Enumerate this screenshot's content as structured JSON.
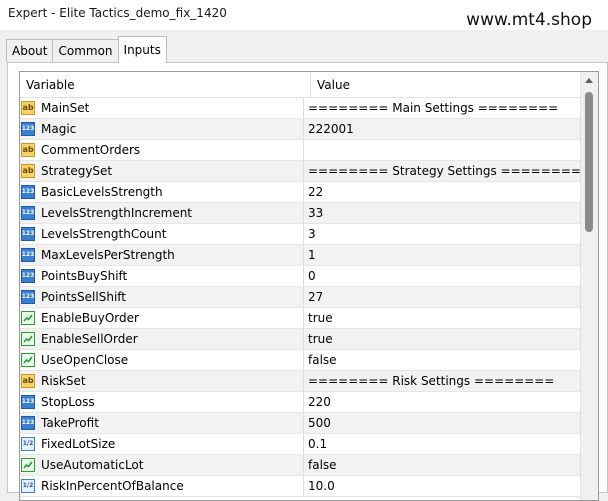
{
  "window": {
    "title": "Expert - Elite Tactics_demo_fix_1420",
    "watermark": "www.mt4.shop"
  },
  "tabs": [
    {
      "label": "About",
      "active": false
    },
    {
      "label": "Common",
      "active": false
    },
    {
      "label": "Inputs",
      "active": true
    }
  ],
  "grid": {
    "headers": {
      "variable": "Variable",
      "value": "Value"
    },
    "rows": [
      {
        "type": "string",
        "name": "MainSet",
        "value": "======== Main Settings ========"
      },
      {
        "type": "int",
        "name": "Magic",
        "value": "222001"
      },
      {
        "type": "string",
        "name": "CommentOrders",
        "value": ""
      },
      {
        "type": "string",
        "name": "StrategySet",
        "value": "======== Strategy Settings ========"
      },
      {
        "type": "int",
        "name": "BasicLevelsStrength",
        "value": "22"
      },
      {
        "type": "int",
        "name": "LevelsStrengthIncrement",
        "value": "33"
      },
      {
        "type": "int",
        "name": "LevelsStrengthCount",
        "value": "3"
      },
      {
        "type": "int",
        "name": "MaxLevelsPerStrength",
        "value": "1"
      },
      {
        "type": "int",
        "name": "PointsBuyShift",
        "value": "0"
      },
      {
        "type": "int",
        "name": "PointsSellShift",
        "value": "27"
      },
      {
        "type": "bool",
        "name": "EnableBuyOrder",
        "value": "true"
      },
      {
        "type": "bool",
        "name": "EnableSellOrder",
        "value": "true"
      },
      {
        "type": "bool",
        "name": "UseOpenClose",
        "value": "false"
      },
      {
        "type": "string",
        "name": "RiskSet",
        "value": "======== Risk Settings ========"
      },
      {
        "type": "int",
        "name": "StopLoss",
        "value": "220"
      },
      {
        "type": "int",
        "name": "TakeProfit",
        "value": "500"
      },
      {
        "type": "double",
        "name": "FixedLotSize",
        "value": "0.1"
      },
      {
        "type": "bool",
        "name": "UseAutomaticLot",
        "value": "false"
      },
      {
        "type": "double",
        "name": "RiskInPercentOfBalance",
        "value": "10.0"
      }
    ]
  },
  "icons": {
    "string": "string-type-icon",
    "int": "integer-type-icon",
    "double": "double-type-icon",
    "bool": "boolean-type-icon"
  },
  "icon_glyphs": {
    "string": "ab",
    "int": "123",
    "double": "1/2",
    "bool": ""
  }
}
